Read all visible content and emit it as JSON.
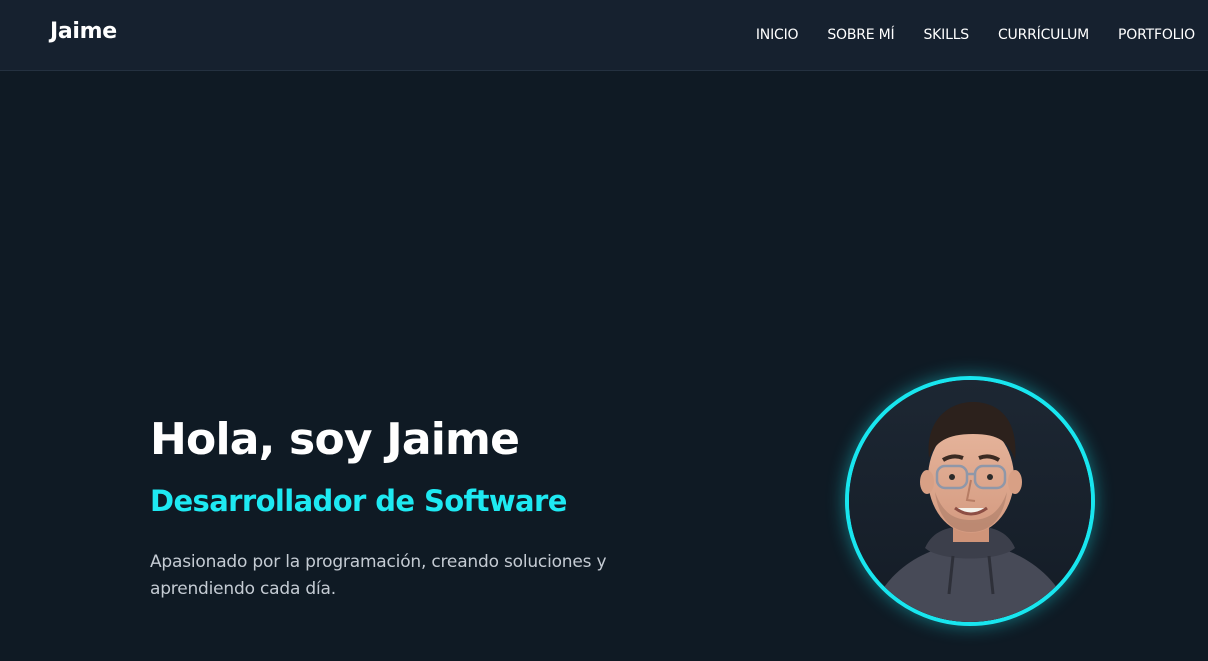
{
  "header": {
    "brand": "Jaime",
    "nav": [
      {
        "label": "INICIO"
      },
      {
        "label": "SOBRE MÍ"
      },
      {
        "label": "SKILLS"
      },
      {
        "label": "CURRÍCULUM"
      },
      {
        "label": "PORTFOLIO"
      }
    ]
  },
  "hero": {
    "title": "Hola, soy Jaime",
    "role": "Desarrollador de Software",
    "description": "Apasionado por la programación, creando soluciones y aprendiendo cada día."
  },
  "colors": {
    "background": "#0f1a24",
    "navbar": "#16212f",
    "accent": "#1ee9f2"
  }
}
